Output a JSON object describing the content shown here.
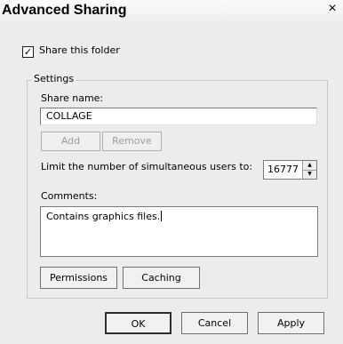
{
  "window": {
    "title": "Advanced Sharing",
    "close_glyph": "×"
  },
  "share": {
    "checkbox_label": "Share this folder",
    "checked": true,
    "check_glyph": "✓"
  },
  "settings": {
    "group_label": "Settings",
    "share_name_label": "Share name:",
    "share_name_value": "COLLAGE",
    "add_label": "Add",
    "remove_label": "Remove",
    "limit_label": "Limit the number of simultaneous users to:",
    "limit_value": "16777",
    "comments_label": "Comments:",
    "comments_value": "Contains graphics files.",
    "permissions_label": "Permissions",
    "caching_label": "Caching"
  },
  "footer": {
    "ok_label": "OK",
    "cancel_label": "Cancel",
    "apply_label": "Apply"
  },
  "icons": {
    "spin_up": "spin-up-icon",
    "spin_down": "spin-down-icon",
    "close": "close-icon",
    "checkmark": "checkmark-icon"
  }
}
